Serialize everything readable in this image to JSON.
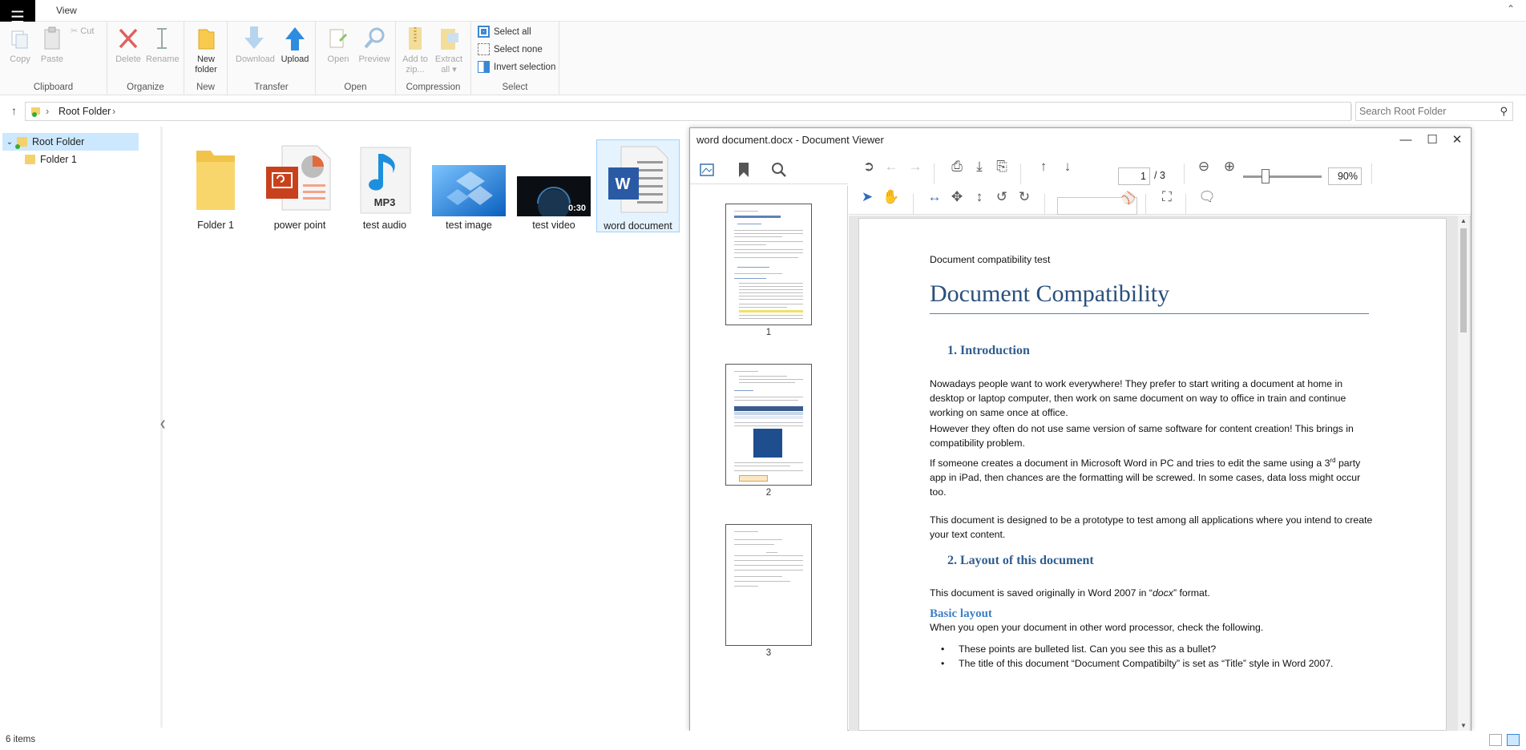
{
  "ribbon": {
    "tab": "View",
    "clipboard": {
      "copy": "Copy",
      "paste": "Paste",
      "cut": "Cut",
      "label": "Clipboard"
    },
    "organize": {
      "delete": "Delete",
      "rename": "Rename",
      "label": "Organize"
    },
    "new": {
      "new_folder_1": "New",
      "new_folder_2": "folder",
      "label": "New"
    },
    "transfer": {
      "download": "Download",
      "upload": "Upload",
      "label": "Transfer"
    },
    "open": {
      "open": "Open",
      "preview": "Preview",
      "label": "Open"
    },
    "compression": {
      "add_1": "Add to",
      "add_2": "zip...",
      "extract_1": "Extract",
      "extract_2": "all",
      "label": "Compression"
    },
    "select": {
      "all": "Select all",
      "none": "Select none",
      "invert": "Invert selection",
      "label": "Select"
    }
  },
  "address": {
    "root": "Root Folder",
    "search_placeholder": "Search Root Folder"
  },
  "tree": {
    "root": "Root Folder",
    "child": "Folder 1"
  },
  "files": [
    {
      "name": "Folder 1"
    },
    {
      "name": "power point"
    },
    {
      "name": "test audio",
      "badge": "MP3"
    },
    {
      "name": "test image"
    },
    {
      "name": "test video",
      "duration": "0:30"
    },
    {
      "name": "word document",
      "badge": "W"
    }
  ],
  "status": {
    "items": "6 items"
  },
  "viewer": {
    "title": "word document.docx - Document Viewer",
    "page_current": "1",
    "page_total": "/ 3",
    "zoom": "90%",
    "thumbnails": [
      "1",
      "2",
      "3"
    ],
    "doc": {
      "header": "Document compatibility test",
      "title": "Document Compatibility",
      "h1_intro": "1.  Introduction",
      "p1": "Nowadays people want to work everywhere! They prefer to start writing a document at home in desktop or laptop computer, then work on same document on way to office in train and continue working on same once at office.",
      "p2": "However they often do not use same version of same software for content creation! This brings in compatibility problem.",
      "p3_a": "If someone creates a document in Microsoft Word in PC and tries to edit the same using a 3",
      "p3_sup": "rd",
      "p3_b": " party app in iPad, then chances are the formatting will be screwed. In some cases, data loss might occur too.",
      "p4": "This document is designed to be a prototype to test among all applications where you intend to create your text content.",
      "h1_layout": "2.  Layout of this document",
      "p5_a": "This document is saved originally in Word 2007 in “",
      "p5_em": "docx",
      "p5_b": "” format.",
      "h2_basic": "Basic layout",
      "p6": "When you open your document in other word processor, check the following.",
      "li1": "These points are bulleted list. Can you see this as a bullet?",
      "li2": "The title of this document “Document Compatibilty” is set as “Title” style in Word 2007."
    }
  }
}
